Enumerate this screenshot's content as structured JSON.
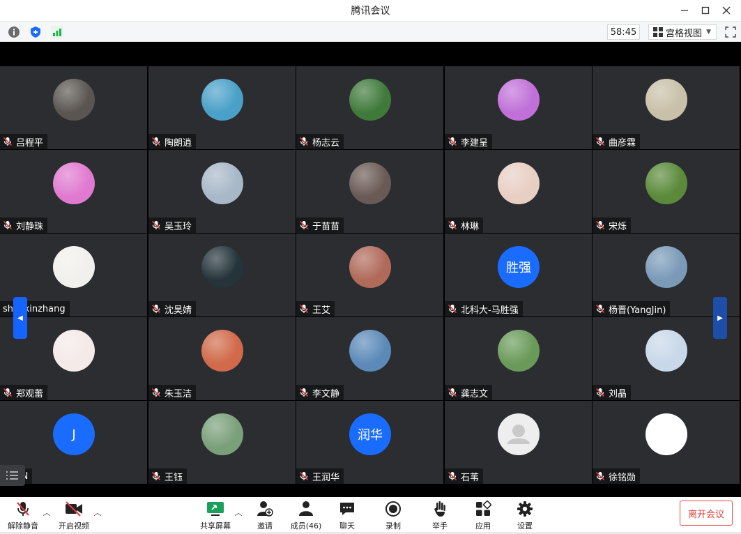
{
  "window": {
    "title": "腾讯会议"
  },
  "infobar": {
    "timer": "58:45",
    "view_mode": "宫格视图",
    "colors": {
      "info": "#6b6b6b",
      "shield": "#1a6cff",
      "signal": "#22b14c"
    }
  },
  "participants": [
    {
      "name": "吕程平",
      "avatar": {
        "type": "photo",
        "icon": "dark-room-photo",
        "bg": "#5a5550"
      }
    },
    {
      "name": "陶朗逍",
      "avatar": {
        "type": "photo",
        "icon": "woman-sea-photo",
        "bg": "#4aa0c8"
      }
    },
    {
      "name": "杨志云",
      "avatar": {
        "type": "photo",
        "icon": "green-valley-photo",
        "bg": "#3f7a3b"
      }
    },
    {
      "name": "李建呈",
      "avatar": {
        "type": "photo",
        "icon": "minion-cartoon",
        "bg": "#c070d8"
      }
    },
    {
      "name": "曲彦霖",
      "avatar": {
        "type": "photo",
        "icon": "lamb-photo",
        "bg": "#c8c0a8"
      }
    },
    {
      "name": "刘静珠",
      "avatar": {
        "type": "photo",
        "icon": "rainbow-spiral",
        "bg": "#e07ad0"
      }
    },
    {
      "name": "吴玉玲",
      "avatar": {
        "type": "photo",
        "icon": "tall-building-photo",
        "bg": "#a8b8c8"
      }
    },
    {
      "name": "于苗苗",
      "avatar": {
        "type": "photo",
        "icon": "girl-portrait-photo",
        "bg": "#6a5a55"
      }
    },
    {
      "name": "林琳",
      "avatar": {
        "type": "photo",
        "icon": "flower-painting",
        "bg": "#e8cfc4"
      }
    },
    {
      "name": "宋烁",
      "avatar": {
        "type": "photo",
        "icon": "park-path-photo",
        "bg": "#5a8a3a"
      }
    },
    {
      "name": "shaoxinzhang",
      "muted": false,
      "avatar": {
        "type": "photo",
        "icon": "calligraphy-seal",
        "bg": "#f2f0ec"
      }
    },
    {
      "name": "沈昊婧",
      "avatar": {
        "type": "photo",
        "icon": "night-tree-photo",
        "bg": "#24343a"
      }
    },
    {
      "name": "王艾",
      "avatar": {
        "type": "photo",
        "icon": "woman-selfie-photo",
        "bg": "#b06a5a"
      }
    },
    {
      "name": "北科大-马胜强",
      "avatar": {
        "type": "letter",
        "text": "胜强",
        "bg": "#1a6cff"
      }
    },
    {
      "name": "杨晋(YangJin)",
      "avatar": {
        "type": "photo",
        "icon": "man-city-photo",
        "bg": "#7a9ab8"
      }
    },
    {
      "name": "郑观蕾",
      "avatar": {
        "type": "photo",
        "icon": "girl-bouquet-illustration",
        "bg": "#f4eae8"
      }
    },
    {
      "name": "朱玉洁",
      "avatar": {
        "type": "photo",
        "icon": "red-sketch-art",
        "bg": "#d06a4a"
      }
    },
    {
      "name": "李文静",
      "avatar": {
        "type": "photo",
        "icon": "city-tower-photo",
        "bg": "#5c8ab8"
      }
    },
    {
      "name": "龚志文",
      "avatar": {
        "type": "photo",
        "icon": "blue-flower-photo",
        "bg": "#6a9a5a"
      }
    },
    {
      "name": "刘晶",
      "avatar": {
        "type": "photo",
        "icon": "snowflake-image",
        "bg": "#c8d8e8"
      }
    },
    {
      "name": "JIN",
      "avatar": {
        "type": "letter",
        "text": "J",
        "bg": "#1a6cff"
      }
    },
    {
      "name": "王钰",
      "avatar": {
        "type": "photo",
        "icon": "two-people-photo",
        "bg": "#7aa07a"
      }
    },
    {
      "name": "王润华",
      "avatar": {
        "type": "letter",
        "text": "润华",
        "bg": "#1a6cff"
      }
    },
    {
      "name": "石苇",
      "avatar": {
        "type": "default",
        "icon": "default-person-icon",
        "bg": "#eeeeee"
      }
    },
    {
      "name": "徐铭勋",
      "avatar": {
        "type": "photo",
        "icon": "university-logo",
        "bg": "#ffffff"
      }
    }
  ],
  "toolbar": {
    "mute": "解除静音",
    "video": "开启视频",
    "share": "共享屏幕",
    "invite": "邀请",
    "members": "成员(46)",
    "chat": "聊天",
    "record": "录制",
    "raise_hand": "举手",
    "apps": "应用",
    "settings": "设置",
    "leave": "离开会议",
    "colors": {
      "leave": "#e23c3c",
      "share": "#1aa05a",
      "mute_slash": "#e23c3c"
    }
  }
}
